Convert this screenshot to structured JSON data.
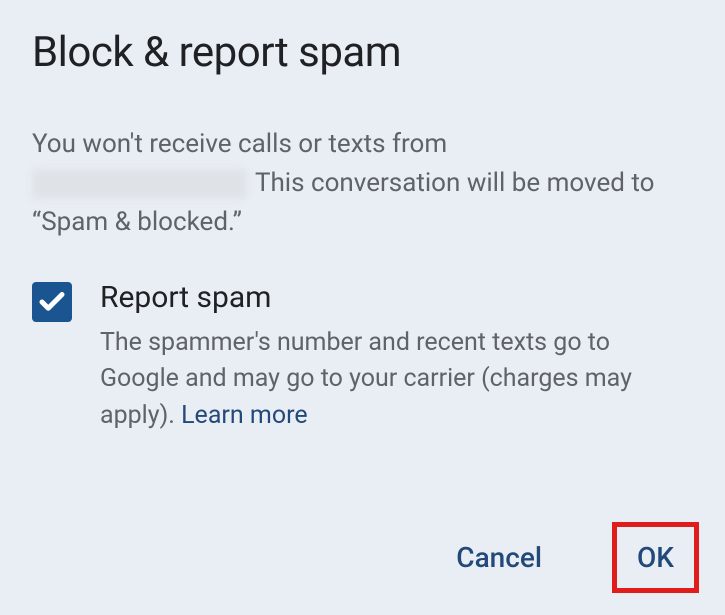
{
  "dialog": {
    "title": "Block & report spam",
    "description_part1": "You won't receive calls or texts from",
    "description_part2": " This conversation will be moved to “Spam & blocked.”",
    "checkbox": {
      "checked": true,
      "label": "Report spam",
      "description": "The spammer's number and recent texts go to Google and may go to your carrier (charges may apply). ",
      "learn_more": "Learn more"
    },
    "actions": {
      "cancel": "Cancel",
      "ok": "OK"
    }
  },
  "annotation": {
    "highlight_color": "#e11c1c"
  }
}
